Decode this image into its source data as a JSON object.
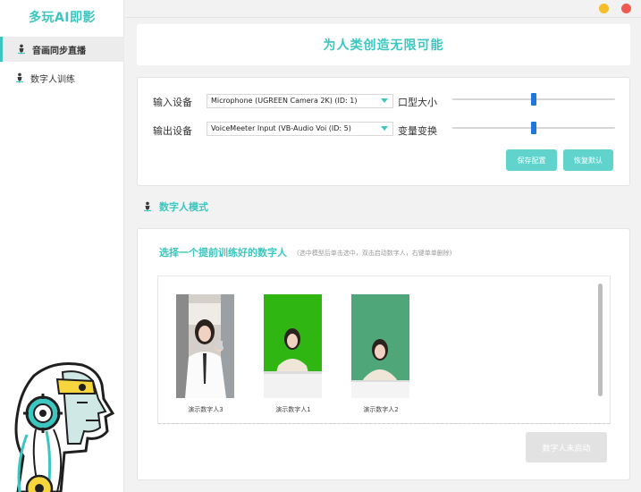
{
  "app": {
    "brand": "多玩AI即影"
  },
  "sidebar": {
    "items": [
      {
        "label": "音画同步直播",
        "active": true
      },
      {
        "label": "数字人训练",
        "active": false
      }
    ]
  },
  "banner": {
    "title": "为人类创造无限可能"
  },
  "settings": {
    "input_device_label": "输入设备",
    "input_device_value": "Microphone (UGREEN Camera 2K) (ID: 1)",
    "mouth_size_label": "口型大小",
    "mouth_size_level": 0.5,
    "output_device_label": "输出设备",
    "output_device_value": "VoiceMeeter Input (VB-Audio Voi (ID: 5)",
    "voice_change_label": "变量变换",
    "voice_change_level": 0.5,
    "save_button": "保存配置",
    "reset_button": "恢复默认"
  },
  "section": {
    "heading": "数字人模式"
  },
  "digital_humans": {
    "title": "选择一个提前训练好的数字人",
    "hint": "(选中模型后单击选中，双击启动数字人，右键单单删除)",
    "items": [
      {
        "caption": "演示数字人3",
        "background": "#d9d4cc"
      },
      {
        "caption": "演示数字人1",
        "background": "#2fb613"
      },
      {
        "caption": "演示数字人2",
        "background": "#4fa679"
      }
    ],
    "start_button": "数字人未启动"
  },
  "colors": {
    "accent": "#3cc6bf",
    "button": "#5fd3cc",
    "slider_thumb": "#1e78d7",
    "window_min": "#f6bd2b",
    "window_close": "#f0594f"
  },
  "icons": [
    "person-pin-icon",
    "robot-illustration",
    "caret-down-icon",
    "window-minimize-icon",
    "window-close-icon"
  ]
}
